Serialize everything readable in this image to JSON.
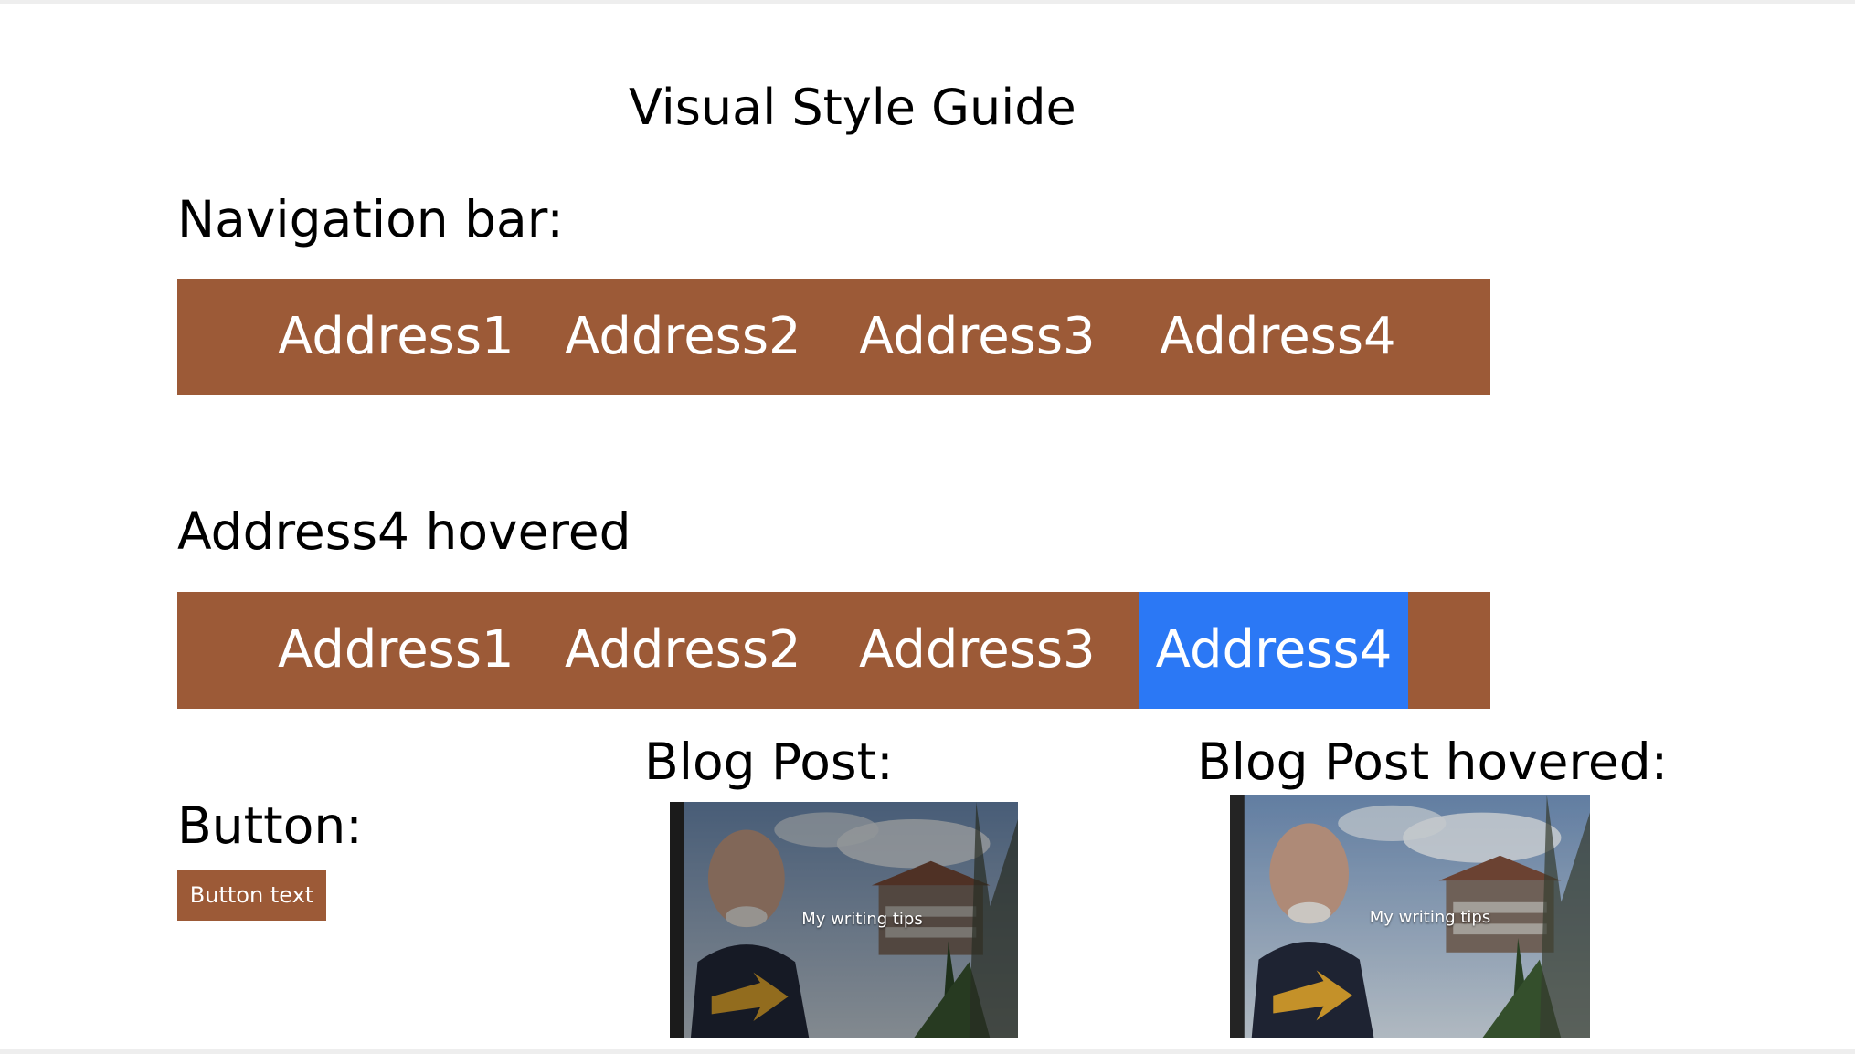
{
  "page": {
    "title": "Visual Style Guide"
  },
  "labels": {
    "navigation_bar": "Navigation bar:",
    "hovered_state": "Address4 hovered",
    "button": "Button:",
    "blog_post": "Blog Post:",
    "blog_post_hovered": "Blog Post hovered:"
  },
  "nav": {
    "items": [
      {
        "label": "Address1"
      },
      {
        "label": "Address2"
      },
      {
        "label": "Address3"
      },
      {
        "label": "Address4"
      }
    ],
    "hovered_index": 3
  },
  "button": {
    "label": "Button text"
  },
  "blog_post": {
    "caption": "My writing tips"
  },
  "colors": {
    "nav_background": "#9c5a37",
    "nav_hover": "#2b78f5",
    "button_background": "#9c5a37",
    "text_on_accent": "#ffffff"
  }
}
